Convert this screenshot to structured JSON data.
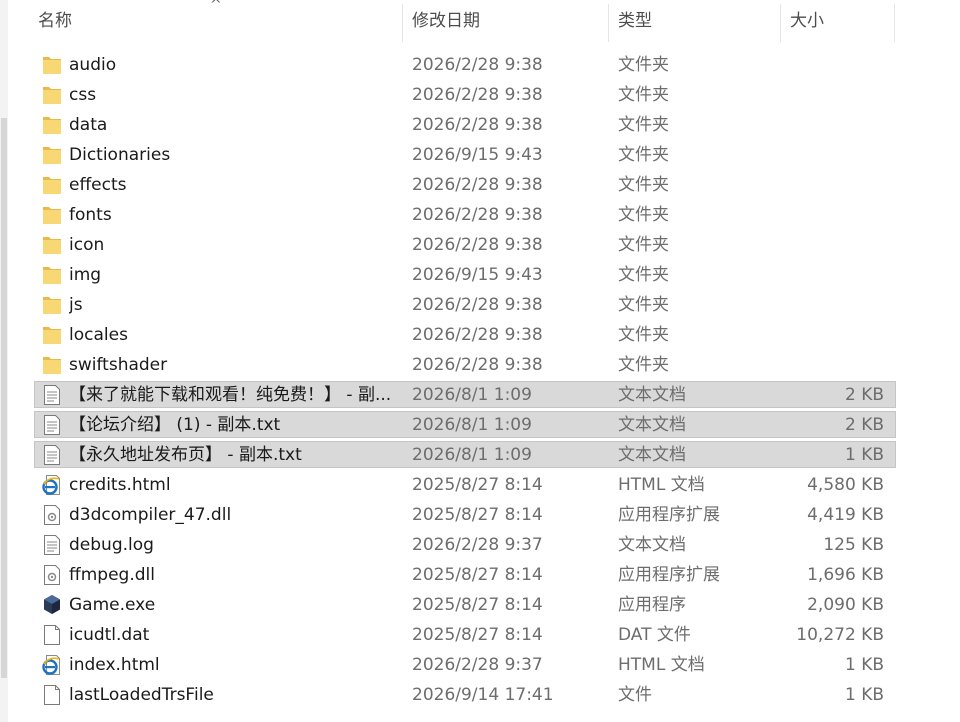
{
  "columns": {
    "name": "名称",
    "date": "修改日期",
    "type": "类型",
    "size": "大小",
    "sort_indicator": "^"
  },
  "files": [
    {
      "name": "audio",
      "date": "2026/2/28 9:38",
      "type": "文件夹",
      "size": "",
      "icon": "folder-icon",
      "selected": false
    },
    {
      "name": "css",
      "date": "2026/2/28 9:38",
      "type": "文件夹",
      "size": "",
      "icon": "folder-icon",
      "selected": false
    },
    {
      "name": "data",
      "date": "2026/2/28 9:38",
      "type": "文件夹",
      "size": "",
      "icon": "folder-icon",
      "selected": false
    },
    {
      "name": "Dictionaries",
      "date": "2026/9/15 9:43",
      "type": "文件夹",
      "size": "",
      "icon": "folder-icon",
      "selected": false
    },
    {
      "name": "effects",
      "date": "2026/2/28 9:38",
      "type": "文件夹",
      "size": "",
      "icon": "folder-icon",
      "selected": false
    },
    {
      "name": "fonts",
      "date": "2026/2/28 9:38",
      "type": "文件夹",
      "size": "",
      "icon": "folder-icon",
      "selected": false
    },
    {
      "name": "icon",
      "date": "2026/2/28 9:38",
      "type": "文件夹",
      "size": "",
      "icon": "folder-icon",
      "selected": false
    },
    {
      "name": "img",
      "date": "2026/9/15 9:43",
      "type": "文件夹",
      "size": "",
      "icon": "folder-icon",
      "selected": false
    },
    {
      "name": "js",
      "date": "2026/2/28 9:38",
      "type": "文件夹",
      "size": "",
      "icon": "folder-icon",
      "selected": false
    },
    {
      "name": "locales",
      "date": "2026/2/28 9:38",
      "type": "文件夹",
      "size": "",
      "icon": "folder-icon",
      "selected": false
    },
    {
      "name": "swiftshader",
      "date": "2026/2/28 9:38",
      "type": "文件夹",
      "size": "",
      "icon": "folder-icon",
      "selected": false
    },
    {
      "name": "【来了就能下载和观看！纯免费！】 - 副...",
      "date": "2026/8/1 1:09",
      "type": "文本文档",
      "size": "2 KB",
      "icon": "text-document-icon",
      "selected": true
    },
    {
      "name": "【论坛介绍】 (1) - 副本.txt",
      "date": "2026/8/1 1:09",
      "type": "文本文档",
      "size": "2 KB",
      "icon": "text-document-icon",
      "selected": true
    },
    {
      "name": "【永久地址发布页】 - 副本.txt",
      "date": "2026/8/1 1:09",
      "type": "文本文档",
      "size": "1 KB",
      "icon": "text-document-icon",
      "selected": true
    },
    {
      "name": "credits.html",
      "date": "2025/8/27 8:14",
      "type": "HTML 文档",
      "size": "4,580 KB",
      "icon": "html-document-icon",
      "selected": false
    },
    {
      "name": "d3dcompiler_47.dll",
      "date": "2025/8/27 8:14",
      "type": "应用程序扩展",
      "size": "4,419 KB",
      "icon": "dll-file-icon",
      "selected": false
    },
    {
      "name": "debug.log",
      "date": "2026/2/28 9:37",
      "type": "文本文档",
      "size": "125 KB",
      "icon": "text-document-icon",
      "selected": false
    },
    {
      "name": "ffmpeg.dll",
      "date": "2025/8/27 8:14",
      "type": "应用程序扩展",
      "size": "1,696 KB",
      "icon": "dll-file-icon",
      "selected": false
    },
    {
      "name": "Game.exe",
      "date": "2025/8/27 8:14",
      "type": "应用程序",
      "size": "2,090 KB",
      "icon": "game-exe-icon",
      "selected": false
    },
    {
      "name": "icudtl.dat",
      "date": "2025/8/27 8:14",
      "type": "DAT 文件",
      "size": "10,272 KB",
      "icon": "blank-file-icon",
      "selected": false
    },
    {
      "name": "index.html",
      "date": "2026/2/28 9:37",
      "type": "HTML 文档",
      "size": "1 KB",
      "icon": "html-document-icon",
      "selected": false
    },
    {
      "name": "lastLoadedTrsFile",
      "date": "2026/9/14 17:41",
      "type": "文件",
      "size": "1 KB",
      "icon": "blank-file-icon",
      "selected": false
    }
  ],
  "colors": {
    "folder": "#f8d775",
    "folder_dark": "#e9b949",
    "selection": "#d9d9d9",
    "html_icon": "#1e73be",
    "game_icon": "#2b3a55"
  }
}
